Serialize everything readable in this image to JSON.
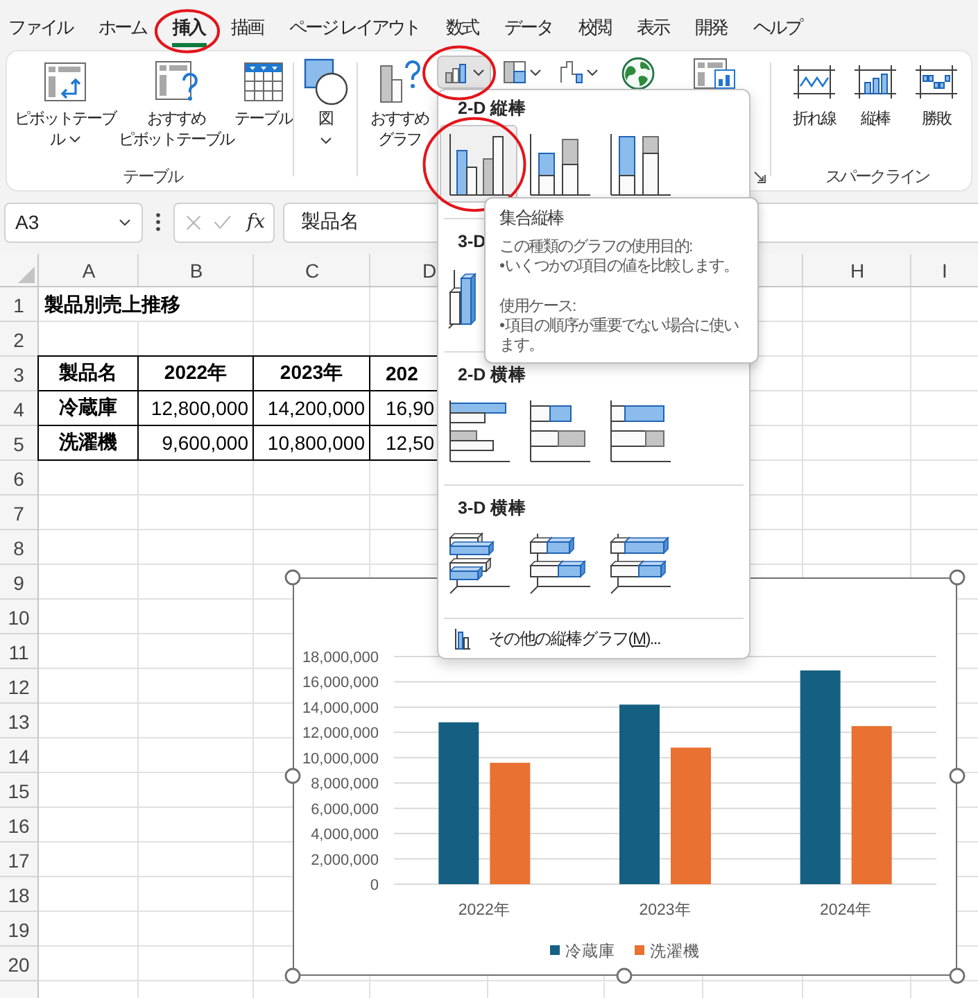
{
  "tabs": [
    {
      "label": "ファイル",
      "selected": false,
      "circled": false
    },
    {
      "label": "ホーム",
      "selected": false,
      "circled": false
    },
    {
      "label": "挿入",
      "selected": true,
      "circled": true
    },
    {
      "label": "描画",
      "selected": false,
      "circled": false
    },
    {
      "label": "ページ レイアウト",
      "selected": false,
      "circled": false
    },
    {
      "label": "数式",
      "selected": false,
      "circled": false
    },
    {
      "label": "データ",
      "selected": false,
      "circled": false
    },
    {
      "label": "校閲",
      "selected": false,
      "circled": false
    },
    {
      "label": "表示",
      "selected": false,
      "circled": false
    },
    {
      "label": "開発",
      "selected": false,
      "circled": false
    },
    {
      "label": "ヘルプ",
      "selected": false,
      "circled": false
    }
  ],
  "ribbon": {
    "groups": [
      {
        "kind": "tables",
        "label": "テーブル",
        "items": [
          {
            "kind": "pivot_table",
            "label": "ピボットテーブル",
            "dropdown": true
          },
          {
            "kind": "recommended_pivot",
            "label_lines": [
              "おすすめ",
              "ピボットテーブル"
            ],
            "dropdown": false
          },
          {
            "kind": "table",
            "label": "テーブル",
            "dropdown": false
          }
        ]
      },
      {
        "kind": "illustrations",
        "items": [
          {
            "kind": "shapes",
            "label": "図",
            "dropdown": true
          }
        ]
      },
      {
        "kind": "charts",
        "items": [
          {
            "kind": "recommended_chart",
            "label": "おすすめグラフ",
            "dropdown": false
          }
        ],
        "chart_buttons": [
          {
            "kind": "column",
            "pressed": true,
            "circled": true
          },
          {
            "kind": "hierarchy",
            "pressed": false,
            "circled": false
          },
          {
            "kind": "waterfall",
            "pressed": false,
            "circled": false
          }
        ],
        "icon_buttons": [
          {
            "kind": "map"
          },
          {
            "kind": "pivot_chart"
          }
        ],
        "dialog_launcher": true
      },
      {
        "kind": "sparklines",
        "label": "スパークライン",
        "items": [
          {
            "kind": "sparkline_line",
            "label": "折れ線",
            "dropdown": false
          },
          {
            "kind": "sparkline_column",
            "label": "縦棒",
            "dropdown": false
          },
          {
            "kind": "sparkline_winloss",
            "label": "勝敗",
            "dropdown": false
          }
        ]
      }
    ]
  },
  "formula_bar": {
    "name_box": "A3",
    "edit_buttons_disabled": true,
    "function_button": "fx",
    "formula": "製品名"
  },
  "sheet": {
    "column_headers": [
      "A",
      "B",
      "C",
      "D",
      "H",
      "I"
    ],
    "row_headers": [
      "1",
      "2",
      "3",
      "4",
      "5",
      "6",
      "7",
      "8",
      "9",
      "10",
      "11",
      "12",
      "13",
      "14",
      "15",
      "16",
      "17",
      "18",
      "19",
      "20"
    ],
    "title": "製品別売上推移",
    "table": {
      "header": [
        "製品名",
        "2022年",
        "2023年",
        "202"
      ],
      "rows": [
        {
          "label": "冷蔵庫",
          "values": [
            "12,800,000",
            "14,200,000",
            "16,90"
          ]
        },
        {
          "label": "洗濯機",
          "values": [
            "9,600,000",
            "10,800,000",
            "12,50"
          ]
        }
      ]
    }
  },
  "chart": {
    "selected": true,
    "chart_data": {
      "type": "bar",
      "orientation": "vertical",
      "grid": true,
      "legend": "bottom",
      "categories": [
        "2022年",
        "2023年",
        "2024年"
      ],
      "series": [
        {
          "name": "冷蔵庫",
          "color": "#156082",
          "values": [
            12800000,
            14200000,
            16900000
          ]
        },
        {
          "name": "洗濯機",
          "color": "#e97132",
          "values": [
            9600000,
            10800000,
            12500000
          ]
        }
      ],
      "ylim": [
        0,
        18000000
      ],
      "yticks": [
        {
          "value": 0,
          "label": "0"
        },
        {
          "value": 2000000,
          "label": "2,000,000"
        },
        {
          "value": 4000000,
          "label": "4,000,000"
        },
        {
          "value": 6000000,
          "label": "6,000,000"
        },
        {
          "value": 8000000,
          "label": "8,000,000"
        },
        {
          "value": 10000000,
          "label": "10,000,000"
        },
        {
          "value": 12000000,
          "label": "12,000,000"
        },
        {
          "value": 14000000,
          "label": "14,000,000"
        },
        {
          "value": 16000000,
          "label": "16,000,000"
        },
        {
          "value": 18000000,
          "label": "18,000,000"
        }
      ]
    }
  },
  "chart_menu": {
    "sections": [
      {
        "heading": "2-D 縦棒",
        "items": [
          {
            "kind": "clustered_column",
            "selected": true,
            "circled": true
          },
          {
            "kind": "stacked_column",
            "selected": false,
            "circled": false
          },
          {
            "kind": "full_stacked_column",
            "selected": false,
            "circled": false
          }
        ]
      },
      {
        "heading": "3-D",
        "items": [
          {
            "kind": "column_3d",
            "selected": false,
            "circled": false
          }
        ]
      },
      {
        "heading": "2-D 横棒",
        "items": [
          {
            "kind": "clustered_bar",
            "selected": false,
            "circled": false
          },
          {
            "kind": "stacked_bar",
            "selected": false,
            "circled": false
          },
          {
            "kind": "full_stacked_bar",
            "selected": false,
            "circled": false
          }
        ]
      },
      {
        "heading": "3-D 横棒",
        "items": [
          {
            "kind": "clustered_bar_3d",
            "selected": false,
            "circled": false
          },
          {
            "kind": "stacked_bar_3d",
            "selected": false,
            "circled": false
          },
          {
            "kind": "full_stacked_bar_3d",
            "selected": false,
            "circled": false
          }
        ]
      }
    ],
    "more": {
      "label_before": "その他の縦棒グラフ(",
      "access_key": "M",
      "label_after": ")..."
    }
  },
  "tooltip": {
    "title": "集合縦棒",
    "sections": [
      {
        "heading": "この種類のグラフの使用目的:",
        "bullet": "• いくつかの項目の値を比較します。"
      },
      {
        "heading": "使用ケース:",
        "bullet": "• 項目の順序が重要でない場合に使います。"
      }
    ]
  }
}
